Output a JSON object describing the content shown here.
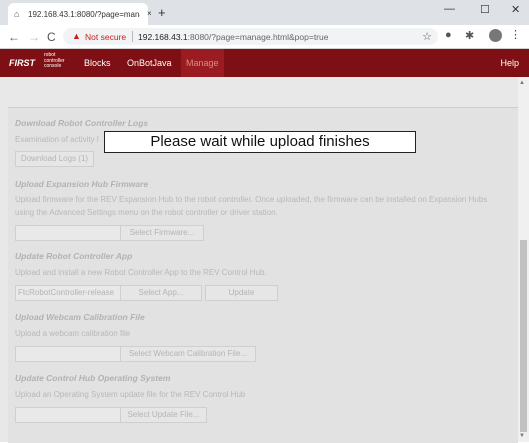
{
  "browser": {
    "tab_title": "192.168.43.1:8080/?page=mana...",
    "tab_close": "×",
    "new_tab": "+",
    "window": {
      "minimize": "—",
      "maximize": "☐",
      "close": "✕"
    },
    "nav": {
      "back": "←",
      "forward": "→",
      "reload": "C"
    },
    "security_label": "Not secure",
    "url_host": "192.168.43.1",
    "url_rest": ":8080/?page=manage.html&pop=true",
    "star": "☆",
    "menu": "⋮"
  },
  "app": {
    "logo": "FIRST",
    "logo_sub": [
      "robot",
      "controller",
      "console"
    ],
    "nav": [
      {
        "label": "Blocks"
      },
      {
        "label": "OnBotJava"
      },
      {
        "label": "Manage",
        "active": true
      }
    ],
    "help": "Help"
  },
  "sections": {
    "logs": {
      "title": "Download Robot Controller Logs",
      "desc": "Examination of activity l",
      "button": "Download Logs (1)"
    },
    "firmware": {
      "title": "Upload Expansion Hub Firmware",
      "desc": "Upload firmware for the REV Expansion Hub to the robot controller. Once uploaded, the firmware can be installed on Expansion Hubs using the Advanced Settings menu on the robot controller or driver station.",
      "button": "Select Firmware..."
    },
    "app_update": {
      "title": "Update Robot Controller App",
      "desc": "Upload and install a new Robot Controller App to the REV Control Hub.",
      "field_value": "FtcRobotController-release",
      "select_button": "Select App...",
      "update_button": "Update"
    },
    "webcam": {
      "title": "Upload Webcam Calibration File",
      "desc": "Upload a webcam calibration file",
      "button": "Select Webcam Calibration File..."
    },
    "os": {
      "title": "Update Control Hub Operating System",
      "desc": "Upload an Operating System update file for the REV Control Hub",
      "button": "Select Update File..."
    }
  },
  "dialog": {
    "message": "Please wait while upload finishes"
  }
}
